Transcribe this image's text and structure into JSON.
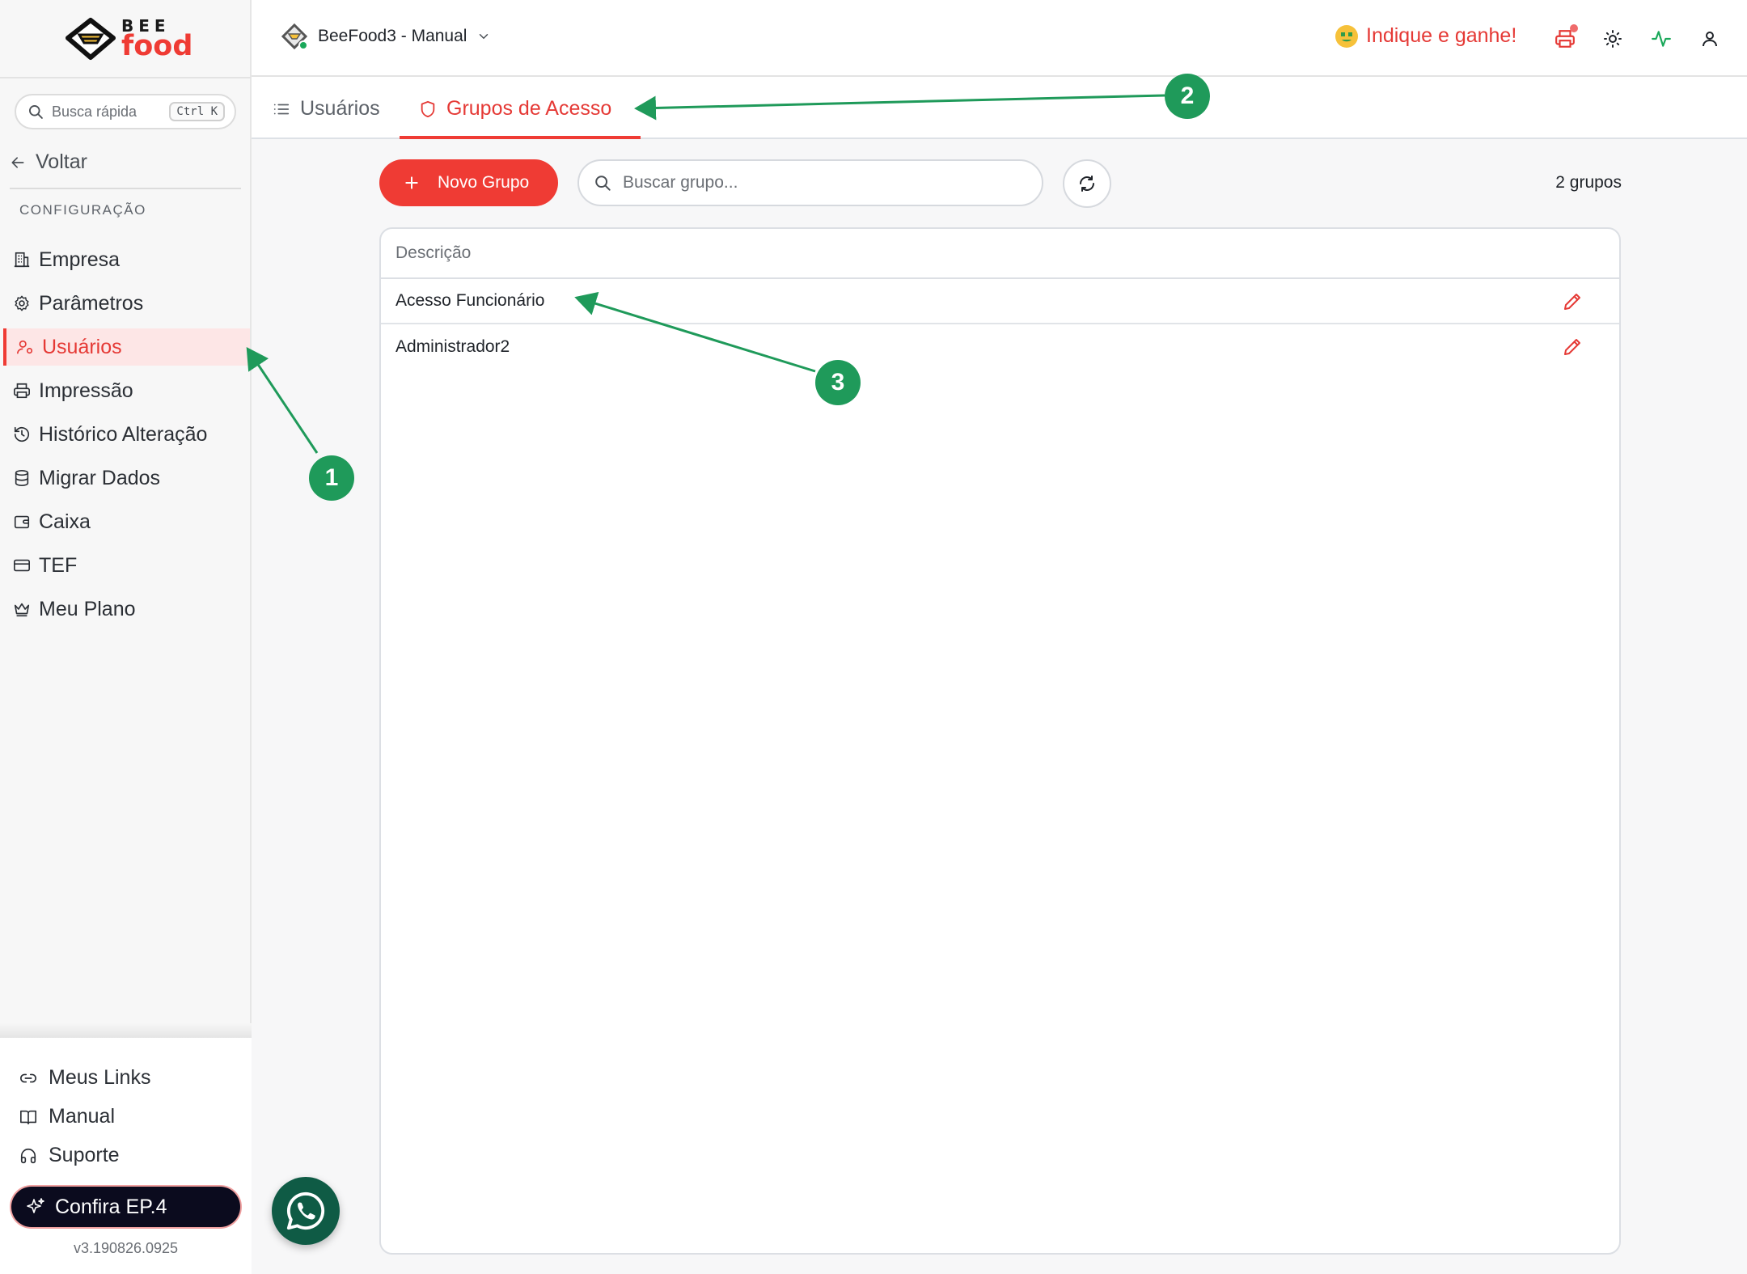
{
  "brand": {
    "name_top": "BEE",
    "name_bottom": "food"
  },
  "search": {
    "label": "Busca rápida",
    "shortcut": "Ctrl K"
  },
  "nav": {
    "back_label": "Voltar",
    "section_label": "CONFIGURAÇÃO",
    "items": [
      {
        "label": "Empresa",
        "icon": "building-icon"
      },
      {
        "label": "Parâmetros",
        "icon": "gear-icon"
      },
      {
        "label": "Usuários",
        "icon": "users-icon",
        "active": true
      },
      {
        "label": "Impressão",
        "icon": "printer-icon"
      },
      {
        "label": "Histórico Alteração",
        "icon": "history-icon"
      },
      {
        "label": "Migrar Dados",
        "icon": "database-icon"
      },
      {
        "label": "Caixa",
        "icon": "wallet-icon"
      },
      {
        "label": "TEF",
        "icon": "credit-card-icon"
      },
      {
        "label": "Meu Plano",
        "icon": "crown-icon"
      }
    ]
  },
  "footer_nav": {
    "links_label": "Meus Links",
    "manual_label": "Manual",
    "support_label": "Suporte",
    "promo_label": "Confira EP.4",
    "version": "v3.190826.0925"
  },
  "header": {
    "store_name": "BeeFood3 - Manual",
    "referral_label": "Indique e ganhe!"
  },
  "tabs": [
    {
      "label": "Usuários",
      "active": false
    },
    {
      "label": "Grupos de Acesso",
      "active": true
    }
  ],
  "toolbar": {
    "new_group_label": "Novo Grupo",
    "search_placeholder": "Buscar grupo...",
    "count_label": "2 grupos"
  },
  "table": {
    "header": "Descrição",
    "rows": [
      "Acesso Funcionário",
      "Administrador2"
    ]
  },
  "annotations": [
    "1",
    "2",
    "3"
  ],
  "colors": {
    "accent": "#ef3b34",
    "annotation": "#1f9a5a",
    "whatsapp": "#0f5b45"
  }
}
